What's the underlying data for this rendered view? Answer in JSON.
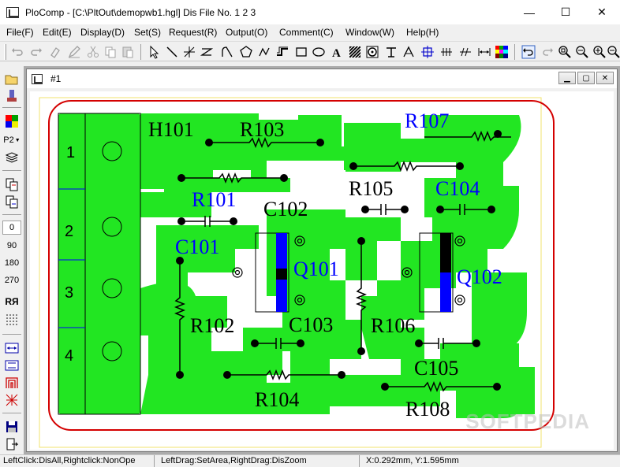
{
  "window": {
    "title": "PloComp - [C:\\PltOut\\demopwb1.hgl] Dis File No. 1 2 3",
    "minimize": "—",
    "maximize": "☐",
    "close": "✕"
  },
  "menu": {
    "items": [
      {
        "label": "File(F)"
      },
      {
        "label": "Edit(E)"
      },
      {
        "label": "Display(D)"
      },
      {
        "label": "Set(S)"
      },
      {
        "label": "Request(R)"
      },
      {
        "label": "Output(O)"
      },
      {
        "label": "Comment(C)"
      },
      {
        "label": "Window(W)"
      },
      {
        "label": "Help(H)"
      }
    ]
  },
  "left_toolbar": {
    "pen_label": "P2",
    "rotation_angles": [
      "0",
      "90",
      "180",
      "270"
    ],
    "mirror_label": "RЯ"
  },
  "child_window": {
    "title": "#1",
    "minimize": "▁",
    "restore": "▢",
    "close": "✕"
  },
  "pcb": {
    "connector_pins": [
      "1",
      "2",
      "3",
      "4"
    ],
    "labels": [
      "H101",
      "R103",
      "R107",
      "R101",
      "R105",
      "C104",
      "C102",
      "C101",
      "Q101",
      "Q102",
      "R102",
      "C103",
      "R106",
      "C105",
      "R104",
      "R108"
    ]
  },
  "status": {
    "mouse_hint": "LeftClick:DisAll,Rightclick:NonOpe",
    "drag_hint": "LeftDrag:SetArea,RightDrag:DisZoom",
    "coords": "X:0.292mm, Y:1.595mm"
  },
  "watermark": "SOFTPEDIA",
  "colors": {
    "copper": "#22e622",
    "outline": "#d40000",
    "component": "#0000ff",
    "trace_black": "#000000"
  }
}
